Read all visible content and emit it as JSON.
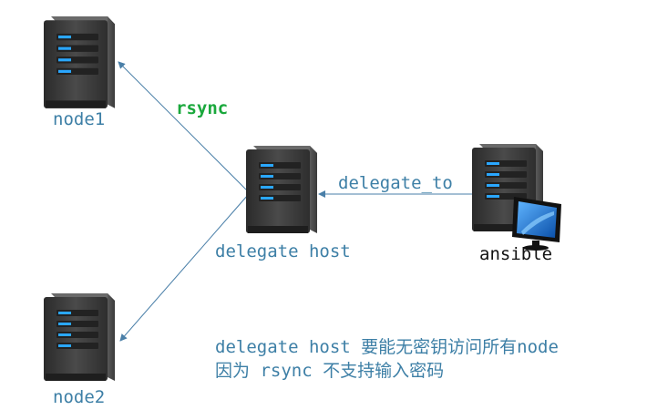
{
  "nodes": {
    "node1": "node1",
    "node2": "node2",
    "delegate_host": "delegate host",
    "ansible": "ansible"
  },
  "edges": {
    "rsync": "rsync",
    "delegate_to": "delegate_to"
  },
  "note": {
    "line1": "delegate host 要能无密钥访问所有node",
    "line2": "因为 rsync 不支持输入密码"
  },
  "colors": {
    "label_blue": "#3d7fa6",
    "rsync_green": "#1aa83c",
    "server_body": "#3a3a3a",
    "led_blue": "#2aa7ff",
    "arrow": "#4a7fa8"
  },
  "icons": {
    "server": "server-icon",
    "monitor": "monitor-icon"
  }
}
